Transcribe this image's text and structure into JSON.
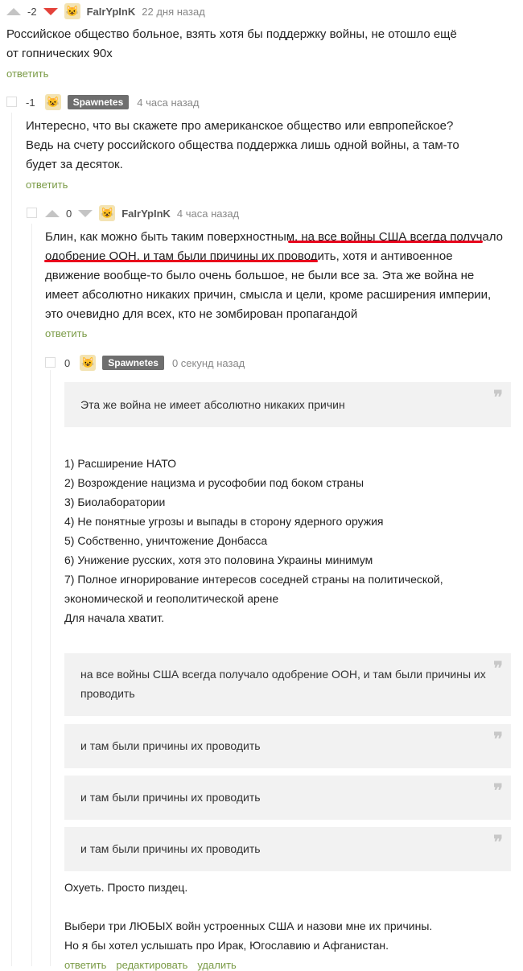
{
  "c1": {
    "rating": "-2",
    "user": "FaIrYpInK",
    "time": "22 дня назад",
    "text": "Российское общество больное, взять хотя бы поддержку войны, не отошло ещё от гопнических 90х",
    "reply": "ответить"
  },
  "c2": {
    "rating": "-1",
    "user": "Spawnetes",
    "time": "4 часа назад",
    "line1": "Интересно, что вы скажете про американское общество или евпропейское?",
    "line2": "Ведь на счету российского общества поддержка лишь одной войны, а там-то будет за десяток.",
    "reply": "ответить"
  },
  "c3": {
    "rating": "0",
    "user": "FaIrYpInK",
    "time": "4 часа назад",
    "part1": "Блин, как можно быть таким поверхностным, ",
    "underlined": "на все войны США всегда получало одобрение ООН, и там были причины их проводить",
    "part2": ", хотя и антивоенное движение вообще-то было очень большое, не были все за. Эта же война не имеет абсолютно никаких причин, смысла и цели, кроме расширения империи, это очевидно для всех, кто не зомбирован пропагандой",
    "reply": "ответить"
  },
  "c4": {
    "rating": "0",
    "user": "Spawnetes",
    "time": "0 секунд назад",
    "quote1": "Эта же война не имеет абсолютно никаких причин",
    "list": [
      "1) Расширение НАТО",
      "2) Возрождение нацизма и русофобии под боком страны",
      "3) Биолаборатории",
      "4) Не понятные угрозы и выпады в сторону ядерного оружия",
      "5) Собственно, уничтожение Донбасса",
      "6) Унижение русских, хотя это половина Украины минимум",
      "7) Полное игнорирование интересов соседней страны на политической, экономической и геополитической арене",
      "Для начала хватит."
    ],
    "quote2": "на все войны США всегда получало одобрение ООН, и там были причины их проводить",
    "quote3": "и там были причины их проводить",
    "quote4": "и там были причины их проводить",
    "quote5": "и там были причины их проводить",
    "after1": "Охуеть. Просто пиздец.",
    "after2": "Выбери три ЛЮБЫХ войн устроенных США и назови мне их причины.",
    "after3": "Но я бы хотел услышать про Ирак, Югославию и Афганистан.",
    "actions": [
      "ответить",
      "редактировать",
      "удалить"
    ]
  },
  "icons": {
    "quote": "quote-icon",
    "avatar": "avatar-icon"
  }
}
